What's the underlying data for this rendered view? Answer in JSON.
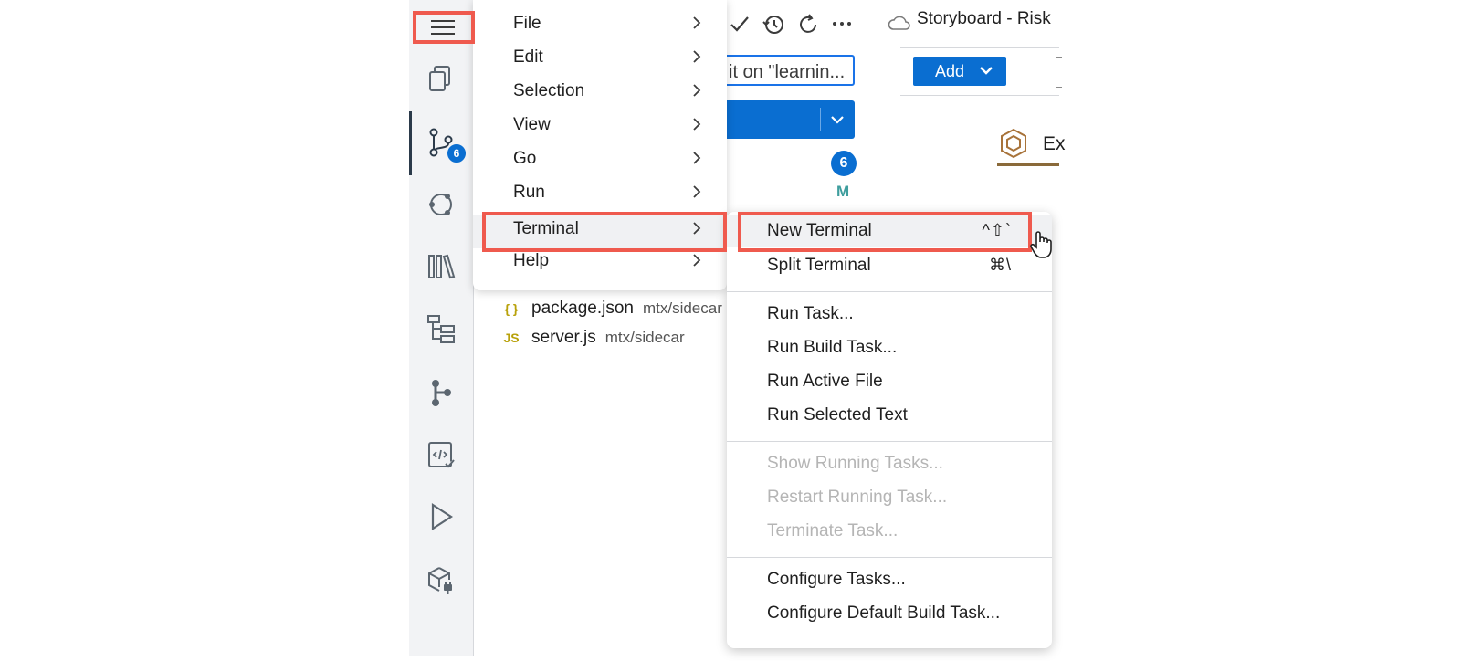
{
  "activity_bar": {
    "scm_badge": "6",
    "icons": [
      "explorer-icon",
      "source-control-icon",
      "graph-icon",
      "library-icon",
      "hierarchy-icon",
      "git-branch-icon",
      "code-check-icon",
      "run-icon",
      "cube-plug-icon"
    ]
  },
  "scm": {
    "commit_placeholder": "it on \"learnin...",
    "changes_count": "6",
    "modified_flag": "M",
    "files": [
      {
        "icon": "{ }",
        "name": "package.json",
        "path": "mtx/sidecar"
      },
      {
        "icon": "JS",
        "name": "server.js",
        "path": "mtx/sidecar"
      }
    ]
  },
  "editor": {
    "tab_title": "Storyboard - Risk",
    "add_label": "Add",
    "explore_label": "Ex"
  },
  "main_menu": {
    "items": [
      {
        "label": "File"
      },
      {
        "label": "Edit"
      },
      {
        "label": "Selection"
      },
      {
        "label": "View"
      },
      {
        "label": "Go"
      },
      {
        "label": "Run"
      },
      {
        "label": "Terminal"
      },
      {
        "label": "Help"
      }
    ]
  },
  "terminal_menu": {
    "new_terminal": {
      "label": "New Terminal",
      "shortcut": "^⇧`"
    },
    "split_terminal": {
      "label": "Split Terminal",
      "shortcut": "⌘\\"
    },
    "run_task": "Run Task...",
    "run_build_task": "Run Build Task...",
    "run_active_file": "Run Active File",
    "run_selected_text": "Run Selected Text",
    "show_running_tasks": "Show Running Tasks...",
    "restart_running_task": "Restart Running Task...",
    "terminate_task": "Terminate Task...",
    "configure_tasks": "Configure Tasks...",
    "configure_default_build_task": "Configure Default Build Task..."
  },
  "colors": {
    "accent": "#0a6ed1",
    "highlight": "#ef5a4e",
    "activity_bg": "#f2f3f5"
  }
}
